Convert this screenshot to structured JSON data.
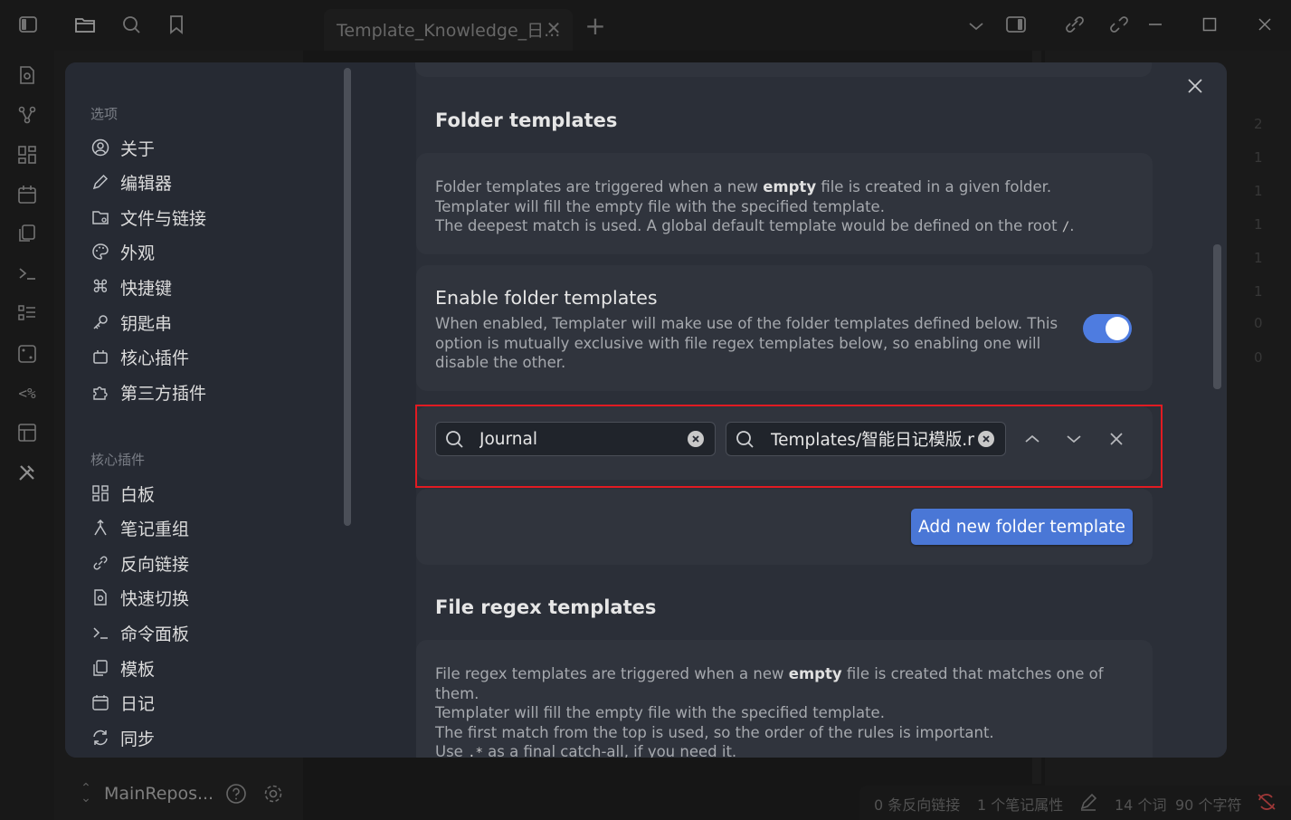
{
  "tab": {
    "title": "Template_Knowledge_日..."
  },
  "left_footer": {
    "vault_name": "MainRepos..."
  },
  "editor_line_numbers": [
    "2",
    "1",
    "1",
    "1",
    "1",
    "1",
    "0",
    "0"
  ],
  "status_bar": {
    "backlinks": "0 条反向链接",
    "properties": "1 个笔记属性",
    "words": "14 个词",
    "characters": "90 个字符"
  },
  "settings_sidebar": {
    "options_heading": "选项",
    "options_items": [
      {
        "label": "关于",
        "icon": "user-circle-icon"
      },
      {
        "label": "编辑器",
        "icon": "pencil-icon"
      },
      {
        "label": "文件与链接",
        "icon": "folder-cog-icon"
      },
      {
        "label": "外观",
        "icon": "palette-icon"
      },
      {
        "label": "快捷键",
        "icon": "command-icon"
      },
      {
        "label": "钥匙串",
        "icon": "key-icon"
      },
      {
        "label": "核心插件",
        "icon": "plug-icon"
      },
      {
        "label": "第三方插件",
        "icon": "puzzle-icon"
      }
    ],
    "core_plugins_heading": "核心插件",
    "core_items": [
      {
        "label": "白板",
        "icon": "canvas-icon"
      },
      {
        "label": "笔记重组",
        "icon": "merge-icon"
      },
      {
        "label": "反向链接",
        "icon": "backlink-icon"
      },
      {
        "label": "快速切换",
        "icon": "file-search-icon"
      },
      {
        "label": "命令面板",
        "icon": "terminal-icon"
      },
      {
        "label": "模板",
        "icon": "files-icon"
      },
      {
        "label": "日记",
        "icon": "calendar-icon"
      },
      {
        "label": "同步",
        "icon": "sync-icon"
      }
    ]
  },
  "folder_templates": {
    "heading": "Folder templates",
    "description_line1_pre": "Folder templates are triggered when a new ",
    "description_line1_bold": "empty",
    "description_line1_post": " file is created in a given folder.",
    "description_line2": "Templater will fill the empty file with the specified template.",
    "description_line3_pre": "The deepest match is used. A global default template would be defined on the root ",
    "description_line3_code": "/",
    "description_line3_post": ".",
    "enable_title": "Enable folder templates",
    "enable_description": "When enabled, Templater will make use of the folder templates defined below. This option is mutually exclusive with file regex templates below, so enabling one will disable the other.",
    "enabled": true,
    "folder_value": "Journal",
    "template_value": "Templates/智能日记模版.m",
    "add_button": "Add new folder template"
  },
  "file_regex_templates": {
    "heading": "File regex templates",
    "line1_pre": "File regex templates are triggered when a new ",
    "line1_bold": "empty",
    "line1_post": " file is created that matches one of them.",
    "line2": "Templater will fill the empty file with the specified template.",
    "line3": "The first match from the top is used, so the order of the rules is important.",
    "line4_pre": "Use ",
    "line4_code": ".*",
    "line4_post": " as a final catch-all, if you need it."
  },
  "colors": {
    "accent": "#4a77d6",
    "highlight_box": "#e11b22"
  }
}
